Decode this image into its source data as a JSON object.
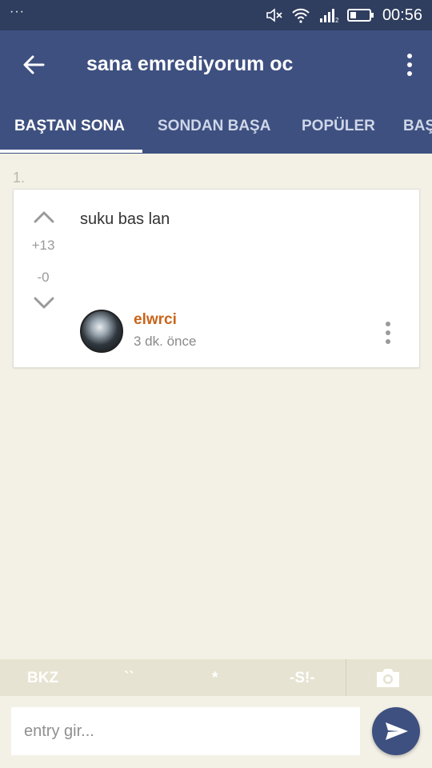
{
  "status_bar": {
    "time": "00:56",
    "icons": [
      "notification-dots-icon",
      "mute-icon",
      "wifi-icon",
      "signal-icon",
      "battery-icon"
    ]
  },
  "app_bar": {
    "title": "sana emrediyorum oc",
    "back_icon": "arrow-left-icon",
    "more_icon": "more-vertical-icon"
  },
  "tabs": [
    {
      "label": "BAŞTAN SONA",
      "active": true
    },
    {
      "label": "SONDAN BAŞA",
      "active": false
    },
    {
      "label": "POPÜLER",
      "active": false
    },
    {
      "label": "BAŞ",
      "active": false
    }
  ],
  "entry": {
    "index": "1.",
    "upvotes": "+13",
    "downvotes": "-0",
    "text": "suku bas lan",
    "author": "elwrci",
    "time_ago": "3 dk. önce"
  },
  "toolbar": {
    "buttons": [
      "BKZ",
      "``",
      "*",
      "-S!-"
    ],
    "camera_icon": "camera-icon"
  },
  "input": {
    "placeholder": "entry gir...",
    "value": ""
  },
  "colors": {
    "primary": "#3e5080",
    "status_bar": "#2f3d5e",
    "background": "#f3f1e6",
    "author": "#c9651a",
    "toolbar": "#e6e3d2"
  }
}
